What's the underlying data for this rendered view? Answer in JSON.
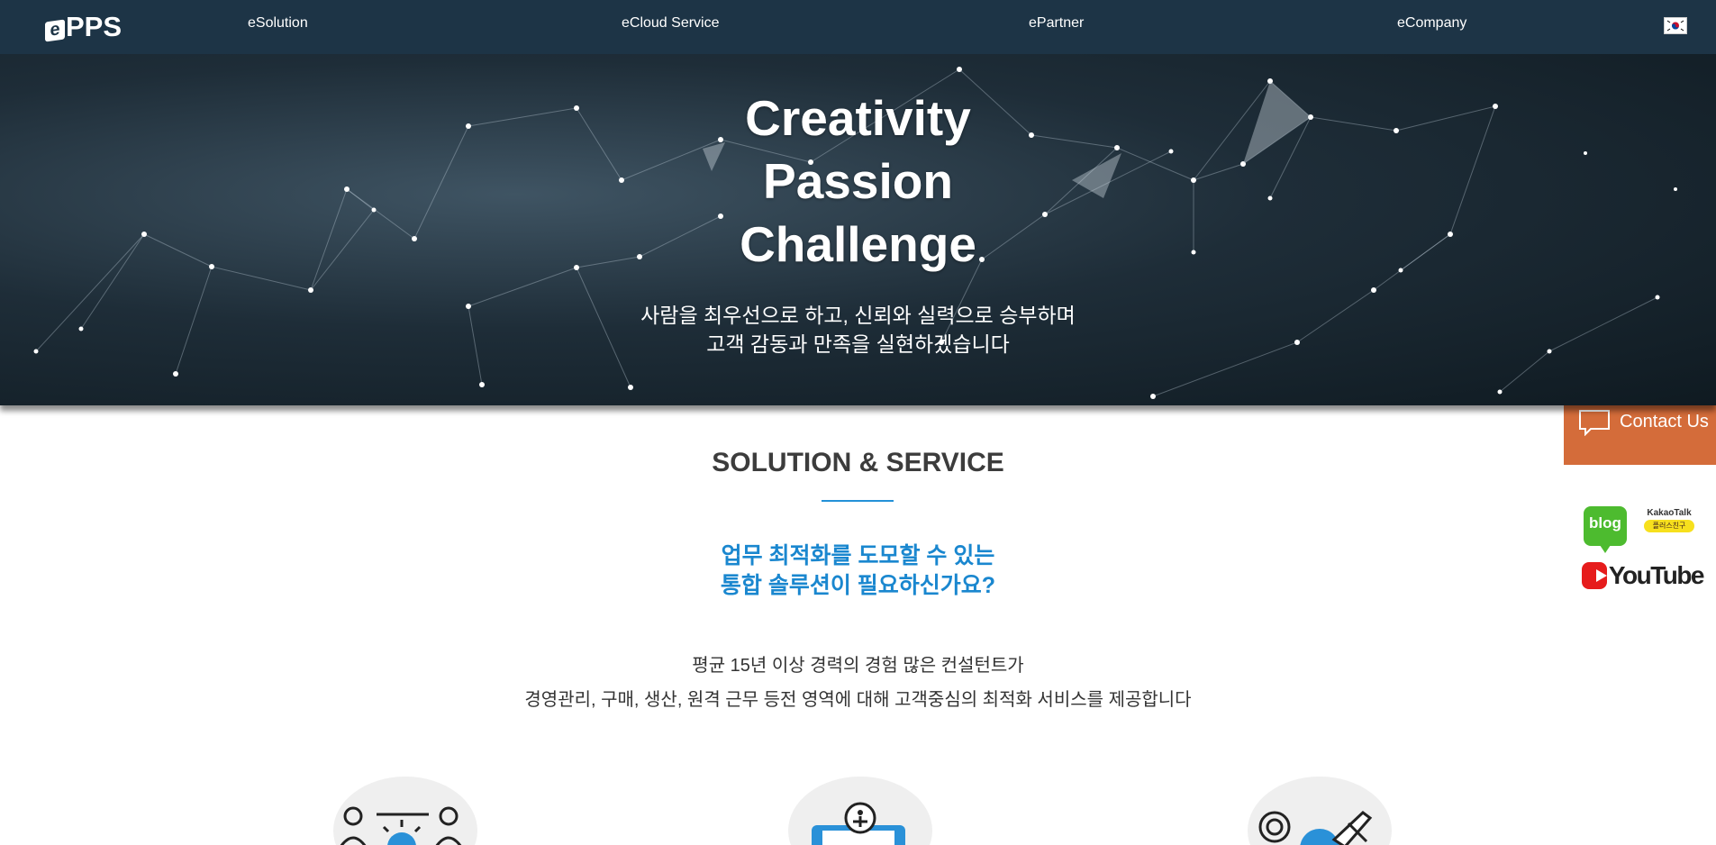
{
  "nav": {
    "logo_text": "PPS",
    "logo_mark": "e",
    "items": [
      {
        "label": "eSolution"
      },
      {
        "label": "eCloud Service"
      },
      {
        "label": "ePartner"
      },
      {
        "label": "eCompany"
      }
    ],
    "language_flag": "korea-flag-icon"
  },
  "hero": {
    "title_lines": [
      "Creativity",
      "Passion",
      "Challenge"
    ],
    "subtitle_lines": [
      "사람을 최우선으로 하고, 신뢰와 실력으로 승부하며",
      "고객 감동과 만족을 실현하겠습니다"
    ]
  },
  "section": {
    "title": "SOLUTION & SERVICE",
    "headline_lines": [
      "업무 최적화를 도모할 수 있는",
      "통합 솔루션이 필요하신가요?"
    ],
    "description_lines": [
      "평균 15년 이상 경력의 경험 많은 컨설턴트가",
      "경영관리, 구매, 생산, 원격 근무 등전 영역에 대해 고객중심의 최적화 서비스를 제공합니다"
    ],
    "cards": [
      {
        "icon": "team-consulting-icon"
      },
      {
        "icon": "cloud-device-icon"
      },
      {
        "icon": "global-travel-icon"
      }
    ]
  },
  "side": {
    "contact_label": "Contact Us",
    "blog_label": "blog",
    "kakao_title": "KakaoTalk",
    "kakao_sub": "플러스친구",
    "youtube_label": "YouTube"
  },
  "colors": {
    "nav_bg": "#1d3446",
    "accent_blue": "#1a87cf",
    "contact_orange": "#d46c3a",
    "blog_green": "#4dbb2f",
    "youtube_red": "#e61c1c"
  }
}
